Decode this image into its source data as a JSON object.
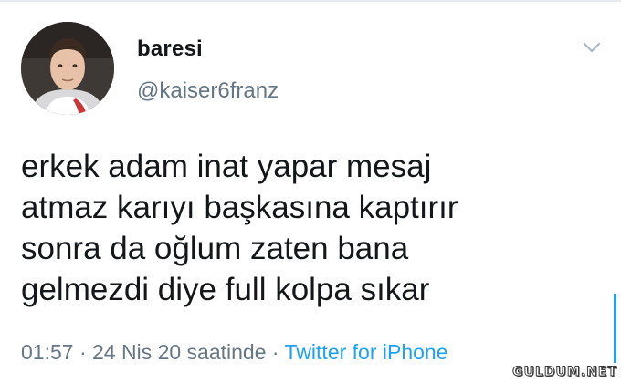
{
  "tweet": {
    "display_name": "baresi",
    "handle": "@kaiser6franz",
    "text_lines": [
      "erkek adam inat yapar mesaj",
      "atmaz karıyı başkasına kaptırır",
      "sonra da oğlum zaten bana",
      "gelmezdi diye full kolpa sıkar"
    ],
    "timestamp": "01:57 · 24 Nis 20 saatinde ·",
    "source": "Twitter for iPhone"
  },
  "icons": {
    "menu": "chevron-down-icon",
    "avatar": "avatar-photo"
  },
  "colors": {
    "text": "#14171a",
    "muted": "#657786",
    "link": "#1da1f2"
  },
  "watermark": "GULDUM.NET"
}
